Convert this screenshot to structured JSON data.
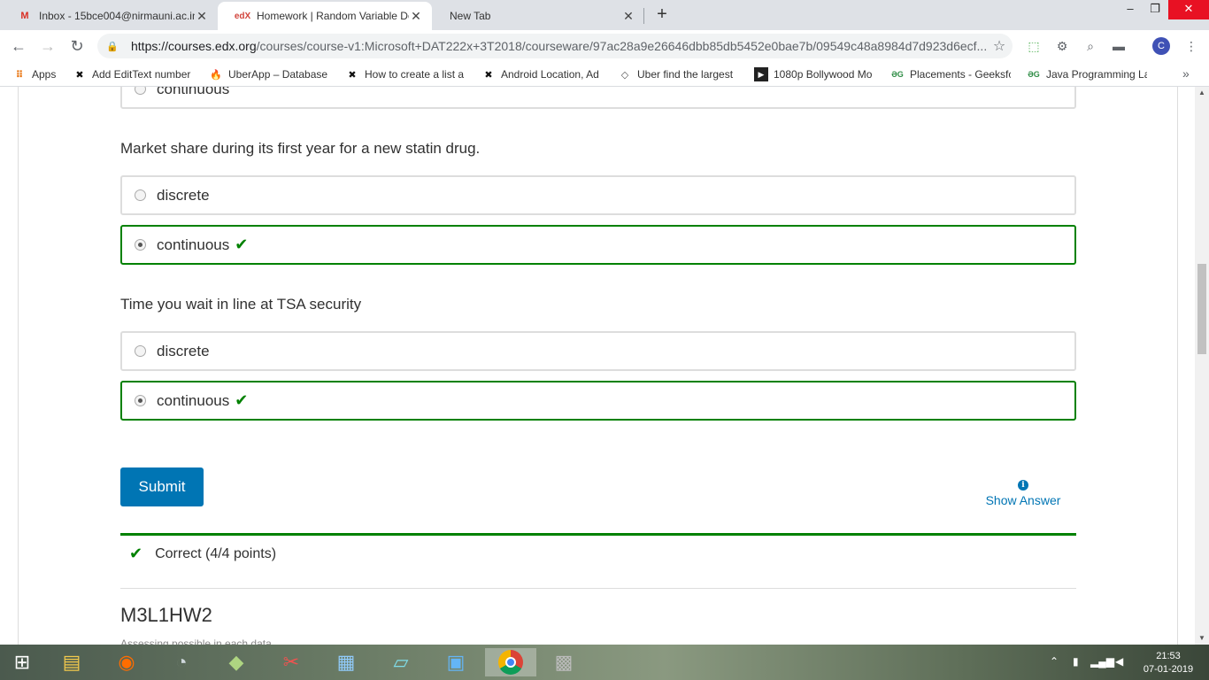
{
  "browser": {
    "tabs": [
      {
        "favicon": "gmail-icon",
        "title": "Inbox - 15bce004@nirmauni.ac.in",
        "active": false
      },
      {
        "favicon": "edx-icon",
        "title": "Homework | Random Variable De",
        "active": true
      },
      {
        "favicon": "",
        "title": "New Tab",
        "active": false
      }
    ],
    "url_host": "https://courses.edx.org",
    "url_path": "/courses/course-v1:Microsoft+DAT222x+3T2018/courseware/97ac28a9e26646dbb85db5452e0bae7b/09549c48a8984d7d923d6ecf...",
    "profile_initial": "C",
    "bookmarks": [
      {
        "icon": "apps-icon",
        "label": "Apps"
      },
      {
        "icon": "xda-icon",
        "label": "Add EditText number"
      },
      {
        "icon": "firebase-icon",
        "label": "UberApp – Database"
      },
      {
        "icon": "xda-icon",
        "label": "How to create a list a"
      },
      {
        "icon": "xda-icon",
        "label": "Android Location, Ad"
      },
      {
        "icon": "quora-icon",
        "label": "Uber find the largest"
      },
      {
        "icon": "video-icon",
        "label": "1080p Bollywood Mo"
      },
      {
        "icon": "gfg-icon",
        "label": "Placements - Geeksfc"
      },
      {
        "icon": "gfg-icon",
        "label": "Java Programming La"
      }
    ]
  },
  "page": {
    "top_partial_choice": "continuous",
    "questions": [
      {
        "text": "Market share during its first year for a new statin drug.",
        "choices": [
          {
            "label": "discrete",
            "selected": false,
            "correct": false
          },
          {
            "label": "continuous",
            "selected": true,
            "correct": true
          }
        ]
      },
      {
        "text": "Time you wait in line at TSA security",
        "choices": [
          {
            "label": "discrete",
            "selected": false,
            "correct": false
          },
          {
            "label": "continuous",
            "selected": true,
            "correct": true
          }
        ]
      }
    ],
    "submit_label": "Submit",
    "show_answer_label": "Show Answer",
    "result_text": "Correct (4/4 points)",
    "next_section_title": "M3L1HW2",
    "cut_off_text": "Assessing possible in each data"
  },
  "taskbar": {
    "time": "21:53",
    "date": "07-01-2019"
  },
  "colors": {
    "correct": "#008100",
    "primary": "#0075b4",
    "text": "#313131"
  }
}
